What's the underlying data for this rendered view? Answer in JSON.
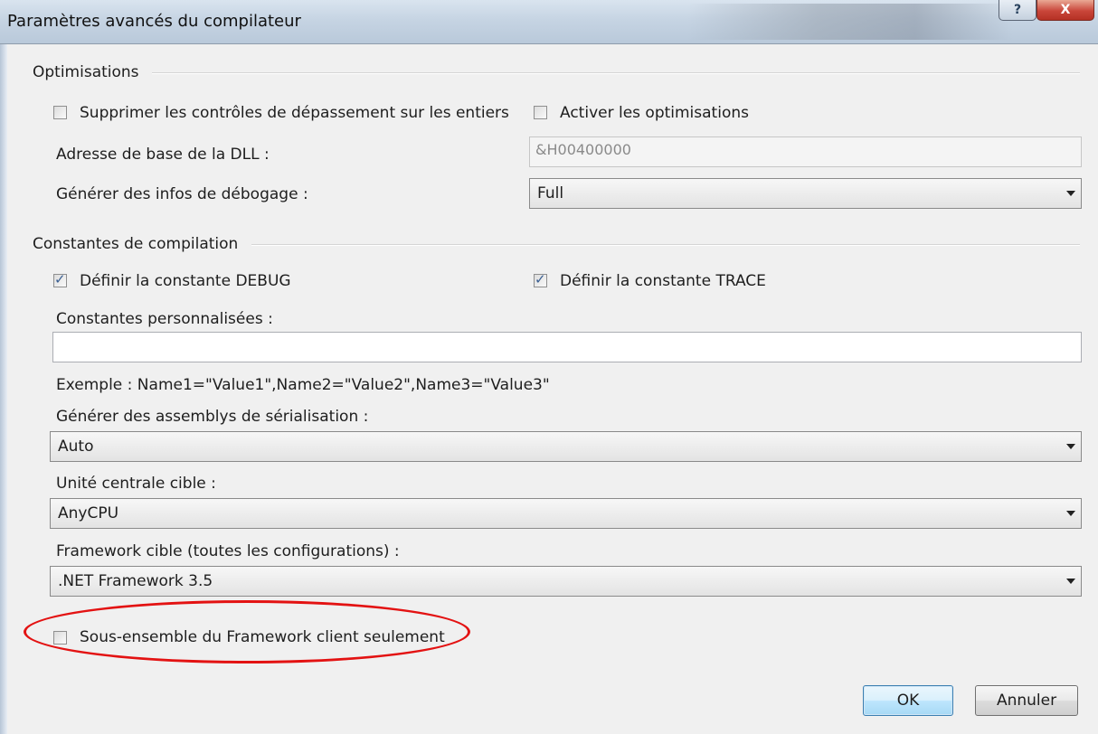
{
  "window": {
    "title": "Paramètres avancés du compilateur",
    "help_glyph": "?",
    "close_glyph": "X"
  },
  "optimisations": {
    "group_label": "Optimisations",
    "suppress_overflow_label": "Supprimer les contrôles de dépassement sur les entiers",
    "suppress_overflow_checked": false,
    "enable_opt_label": "Activer les optimisations",
    "enable_opt_checked": false,
    "dll_base_label": "Adresse de base de la DLL :",
    "dll_base_value": "&H00400000",
    "debug_info_label": "Générer des infos de débogage :",
    "debug_info_value": "Full"
  },
  "constants": {
    "group_label": "Constantes de compilation",
    "debug_label": "Définir la constante DEBUG",
    "debug_checked": true,
    "trace_label": "Définir la constante TRACE",
    "trace_checked": true,
    "custom_label": "Constantes personnalisées :",
    "custom_value": "",
    "example_text": "Exemple : Name1=\"Value1\",Name2=\"Value2\",Name3=\"Value3\"",
    "serialization_label": "Générer des assemblys de sérialisation :",
    "serialization_value": "Auto",
    "target_cpu_label": "Unité centrale cible :",
    "target_cpu_value": "AnyCPU",
    "framework_label": "Framework cible (toutes les configurations) :",
    "framework_value": ".NET Framework 3.5",
    "client_subset_label": "Sous-ensemble du Framework client seulement",
    "client_subset_checked": false
  },
  "buttons": {
    "ok": "OK",
    "cancel": "Annuler"
  },
  "colors": {
    "highlight_ellipse": "#e31212",
    "checkmark": "#3a5f92"
  }
}
